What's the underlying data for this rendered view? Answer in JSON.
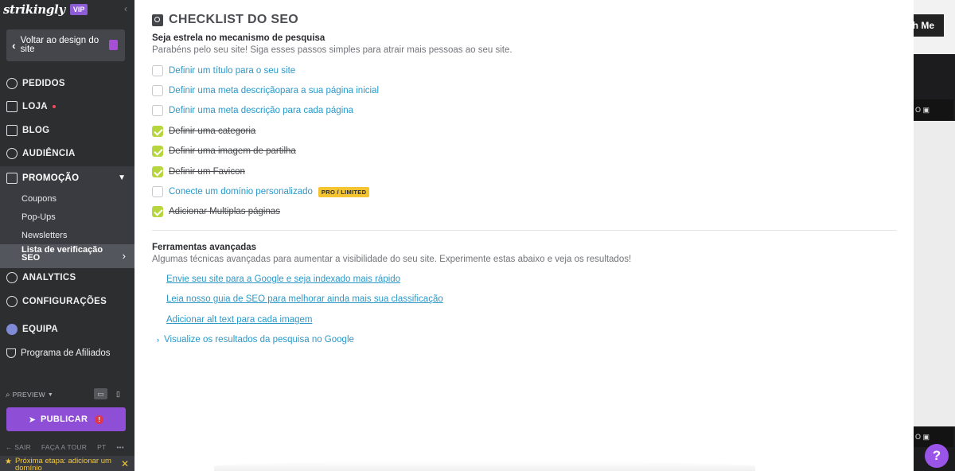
{
  "sidebar": {
    "logo": "strikingly",
    "vip": "VIP",
    "back_label": "Voltar ao design do site",
    "nav": {
      "pedidos": "PEDIDOS",
      "loja": "LOJA",
      "blog": "BLOG",
      "audiencia": "AUDIÊNCIA",
      "promocao": "PROMOÇÃO",
      "analytics": "ANALYTICS",
      "configuracoes": "CONFIGURAÇÕES",
      "equipa": "EQUIPA",
      "afiliados": "Programa de Afiliados"
    },
    "promo_sub": [
      "Coupons",
      "Pop-Ups",
      "Newsletters"
    ],
    "active_sub": "Lista de verificação SEO",
    "preview": "PREVIEW",
    "publish": "PUBLICAR",
    "publish_alert": "!",
    "footer": {
      "sair": "SAIR",
      "tour": "FAÇA A TOUR",
      "lang": "PT",
      "more": "•••"
    },
    "next_step": "Próxima etapa: adicionar um domínio"
  },
  "background": {
    "button_partial": "th Me",
    "label_partial_1": "O",
    "label_partial_2": "O",
    "help": "?"
  },
  "panel": {
    "title": "CHECKLIST DO SEO",
    "section1_title": "Seja estrela no mecanismo de pesquisa",
    "section1_desc": "Parabéns pelo seu site! Siga esses passos simples para atrair mais pessoas ao seu site.",
    "checklist": [
      {
        "label": "Definir um título para o seu site",
        "done": false
      },
      {
        "label": "Definir uma meta descriçãopara a sua página inicial",
        "done": false
      },
      {
        "label": "Definir uma meta descrição para cada página",
        "done": false
      },
      {
        "label": "Definir uma categoria",
        "done": true
      },
      {
        "label": "Definir uma imagem de partilha",
        "done": true
      },
      {
        "label": "Definir um Favicon",
        "done": true
      },
      {
        "label": "Conecte um domínio personalizado",
        "done": false,
        "badge": "PRO / LIMITED"
      },
      {
        "label": "Adicionar Multiplas páginas",
        "done": true
      }
    ],
    "section2_title": "Ferramentas avançadas",
    "section2_desc": "Algumas técnicas avançadas para aumentar a visibilidade do seu site. Experimente estas abaixo e veja os resultados!",
    "advanced_links": [
      "Envie seu site para a Google e seja indexado mais rápido",
      "Leia nosso guia de SEO para melhorar ainda mais sua classificação",
      "Adicionar alt text para cada imagem"
    ],
    "advanced_expand": "Visualize os resultados da pesquisa no Google"
  }
}
